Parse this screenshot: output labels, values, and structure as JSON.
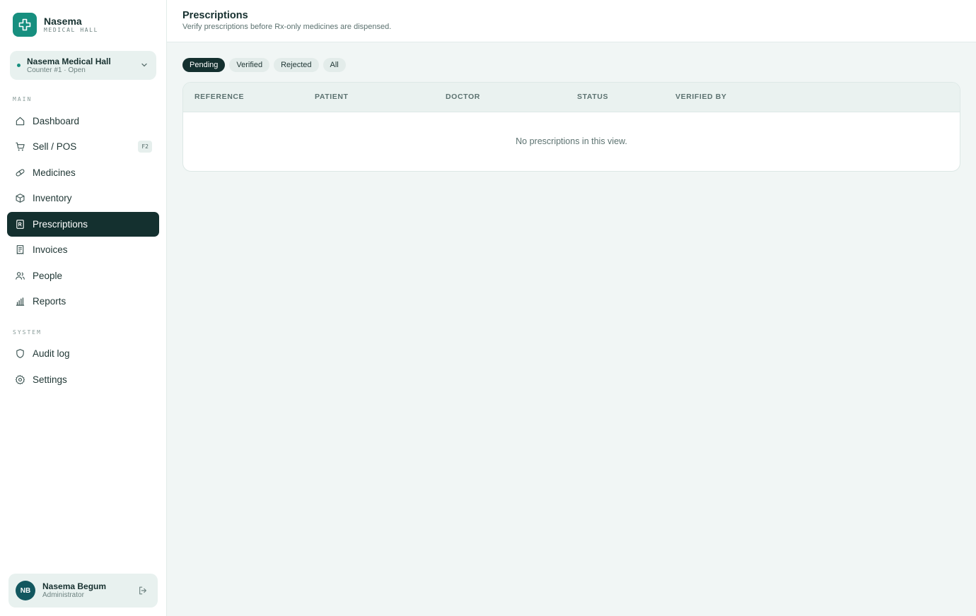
{
  "brand": {
    "name": "Nasema",
    "subtitle": "MEDICAL HALL",
    "accent": "#178f7f"
  },
  "store": {
    "name": "Nasema Medical Hall",
    "status": "Counter #1 · Open"
  },
  "nav": {
    "main_label": "MAIN",
    "main_items": [
      {
        "label": "Dashboard",
        "icon": "home-icon"
      },
      {
        "label": "Sell / POS",
        "icon": "cart-icon",
        "shortcut": "F2"
      },
      {
        "label": "Medicines",
        "icon": "pill-icon"
      },
      {
        "label": "Inventory",
        "icon": "box-icon"
      },
      {
        "label": "Prescriptions",
        "icon": "prescription-icon",
        "active": true
      },
      {
        "label": "Invoices",
        "icon": "receipt-icon"
      },
      {
        "label": "People",
        "icon": "users-icon"
      },
      {
        "label": "Reports",
        "icon": "bar-chart-icon"
      }
    ],
    "system_label": "SYSTEM",
    "system_items": [
      {
        "label": "Audit log",
        "icon": "shield-icon"
      },
      {
        "label": "Settings",
        "icon": "gear-icon"
      }
    ]
  },
  "user": {
    "initials": "NB",
    "name": "Nasema Begum",
    "role": "Administrator"
  },
  "page": {
    "title": "Prescriptions",
    "subtitle": "Verify prescriptions before Rx-only medicines are dispensed."
  },
  "filters": {
    "tabs": [
      "Pending",
      "Verified",
      "Rejected",
      "All"
    ],
    "selected": "Pending"
  },
  "table": {
    "columns": [
      "REFERENCE",
      "PATIENT",
      "DOCTOR",
      "STATUS",
      "VERIFIED BY"
    ],
    "rows": [],
    "empty_message": "No prescriptions in this view."
  }
}
